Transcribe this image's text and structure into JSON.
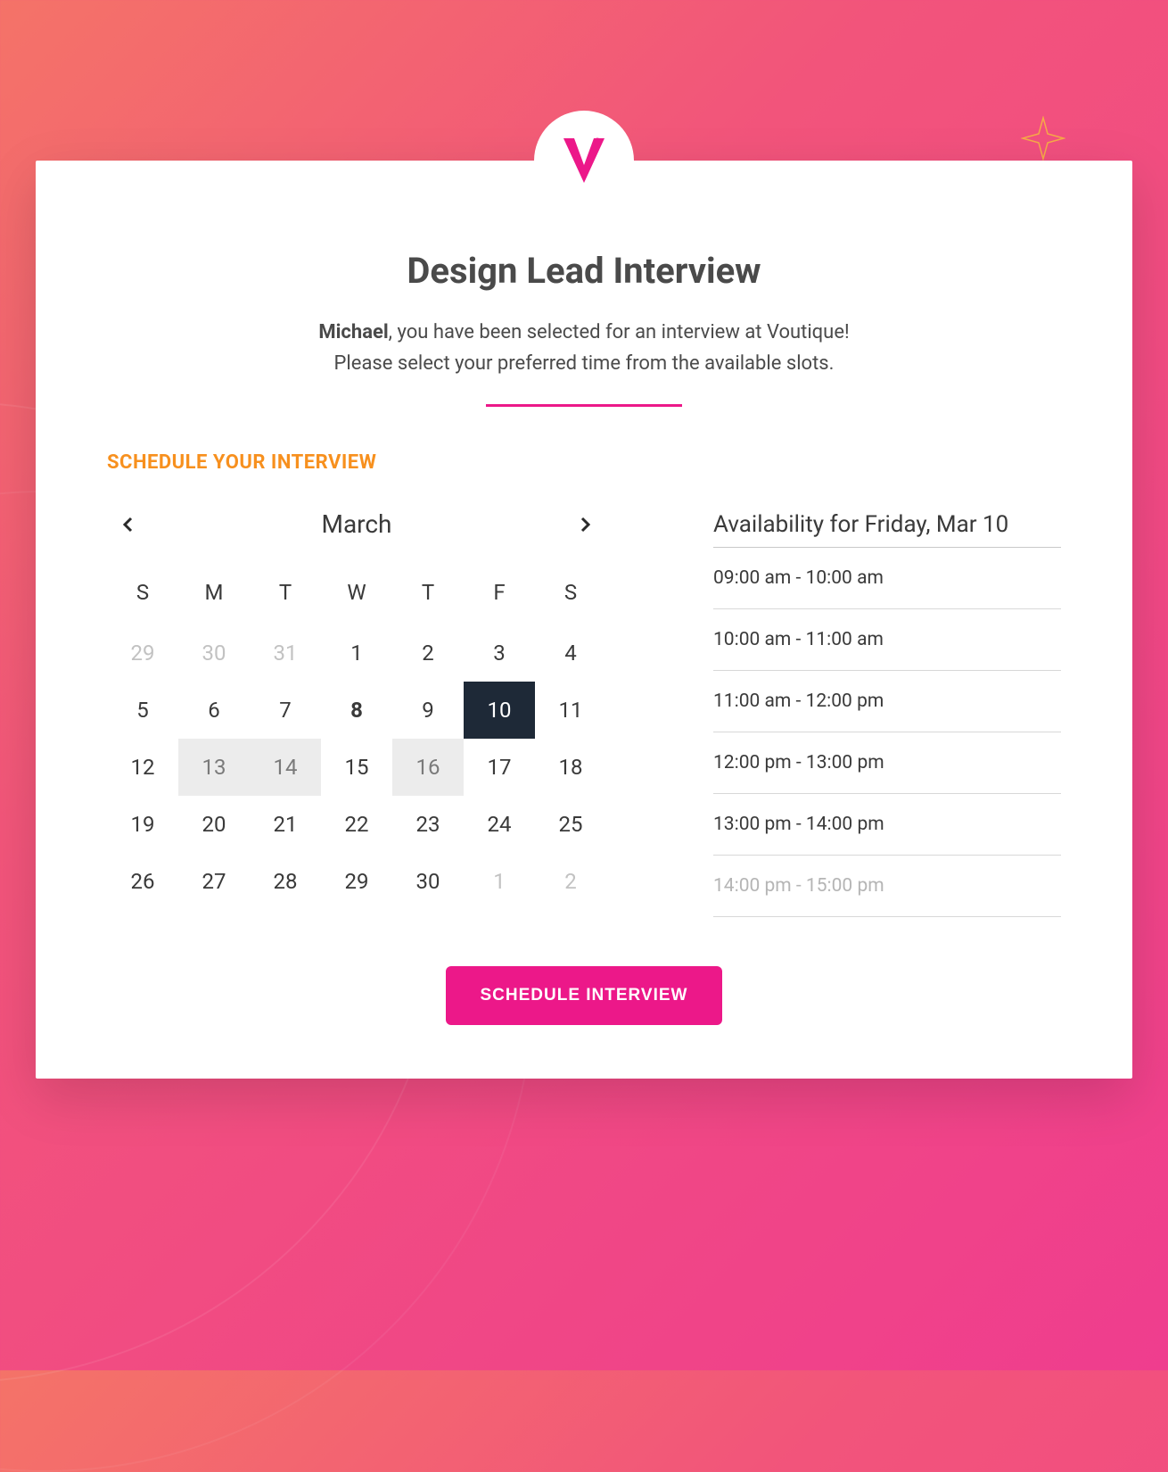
{
  "header": {
    "title": "Design Lead Interview",
    "intro_bold": "Michael",
    "intro_line1": ", you have been selected for an interview at Voutique!",
    "intro_line2": "Please select your preferred time from the available slots."
  },
  "section_label": "SCHEDULE YOUR INTERVIEW",
  "calendar": {
    "month": "March",
    "dow": [
      "S",
      "M",
      "T",
      "W",
      "T",
      "F",
      "S"
    ],
    "cells": [
      {
        "n": "29",
        "state": "muted"
      },
      {
        "n": "30",
        "state": "muted"
      },
      {
        "n": "31",
        "state": "muted"
      },
      {
        "n": "1"
      },
      {
        "n": "2"
      },
      {
        "n": "3"
      },
      {
        "n": "4"
      },
      {
        "n": "5"
      },
      {
        "n": "6"
      },
      {
        "n": "7"
      },
      {
        "n": "8",
        "state": "bold"
      },
      {
        "n": "9"
      },
      {
        "n": "10",
        "state": "selected"
      },
      {
        "n": "11"
      },
      {
        "n": "12"
      },
      {
        "n": "13",
        "state": "shaded"
      },
      {
        "n": "14",
        "state": "shaded"
      },
      {
        "n": "15"
      },
      {
        "n": "16",
        "state": "shaded"
      },
      {
        "n": "17"
      },
      {
        "n": "18"
      },
      {
        "n": "19"
      },
      {
        "n": "20"
      },
      {
        "n": "21"
      },
      {
        "n": "22"
      },
      {
        "n": "23"
      },
      {
        "n": "24"
      },
      {
        "n": "25"
      },
      {
        "n": "26"
      },
      {
        "n": "27"
      },
      {
        "n": "28"
      },
      {
        "n": "29"
      },
      {
        "n": "30"
      },
      {
        "n": "1",
        "state": "muted"
      },
      {
        "n": "2",
        "state": "muted"
      }
    ]
  },
  "availability": {
    "title": "Availability for Friday, Mar 10",
    "slots": [
      {
        "text": "09:00 am - 10:00 am"
      },
      {
        "text": "10:00 am - 11:00 am"
      },
      {
        "text": "11:00 am - 12:00 pm"
      },
      {
        "text": "12:00 pm - 13:00 pm"
      },
      {
        "text": "13:00 pm - 14:00 pm"
      },
      {
        "text": "14:00 pm - 15:00 pm",
        "faded": true
      }
    ]
  },
  "button_label": "SCHEDULE INTERVIEW"
}
